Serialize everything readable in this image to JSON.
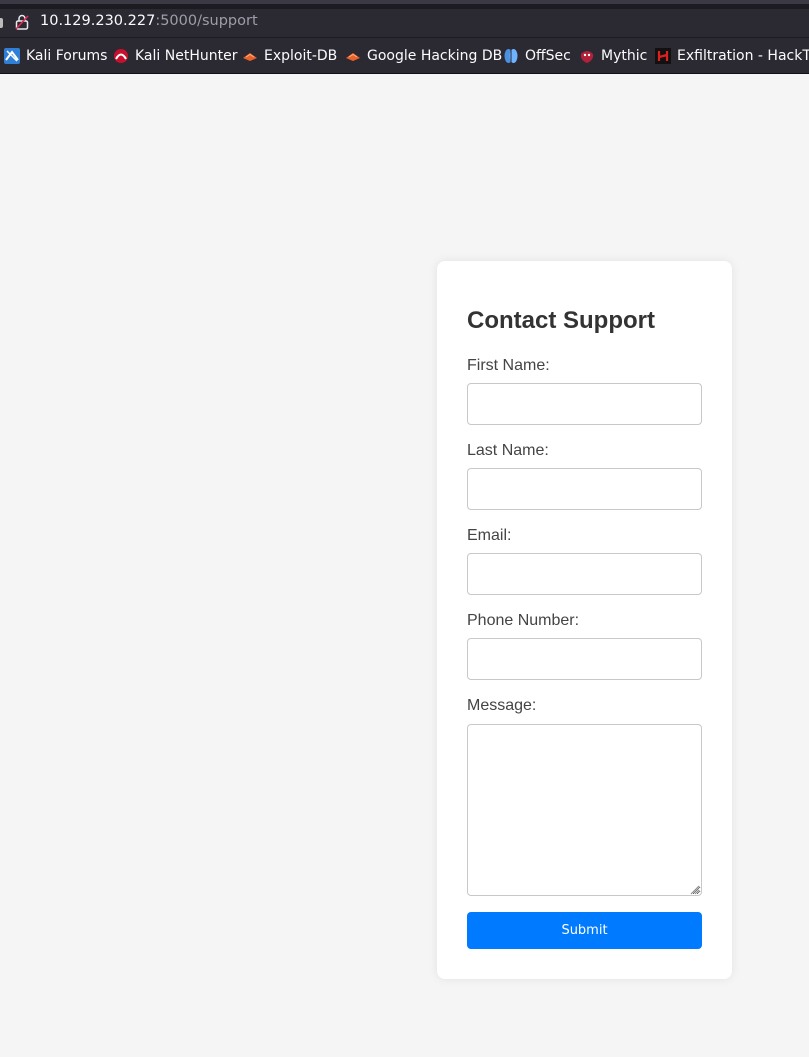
{
  "browser": {
    "url_host": "10.129.230.227",
    "url_rest": ":5000/support",
    "bookmarks": [
      {
        "label": "Kali Forums",
        "icon": "kali-dragon-icon"
      },
      {
        "label": "Kali NetHunter",
        "icon": "nethunter-icon"
      },
      {
        "label": "Exploit-DB",
        "icon": "exploit-db-icon"
      },
      {
        "label": "Google Hacking DB",
        "icon": "ghdb-icon"
      },
      {
        "label": "OffSec",
        "icon": "offsec-icon"
      },
      {
        "label": "Mythic",
        "icon": "mythic-icon"
      },
      {
        "label": "Exfiltration - HackTri",
        "icon": "hacktricks-icon"
      }
    ]
  },
  "form": {
    "title": "Contact Support",
    "first_name_label": "First Name:",
    "first_name_value": "",
    "last_name_label": "Last Name:",
    "last_name_value": "",
    "email_label": "Email:",
    "email_value": "",
    "phone_label": "Phone Number:",
    "phone_value": "",
    "message_label": "Message:",
    "message_value": "",
    "submit_label": "Submit"
  },
  "colors": {
    "page_bg": "#f5f5f5",
    "card_bg": "#ffffff",
    "submit_bg": "#007bff",
    "browser_bg": "#2b2a33"
  }
}
